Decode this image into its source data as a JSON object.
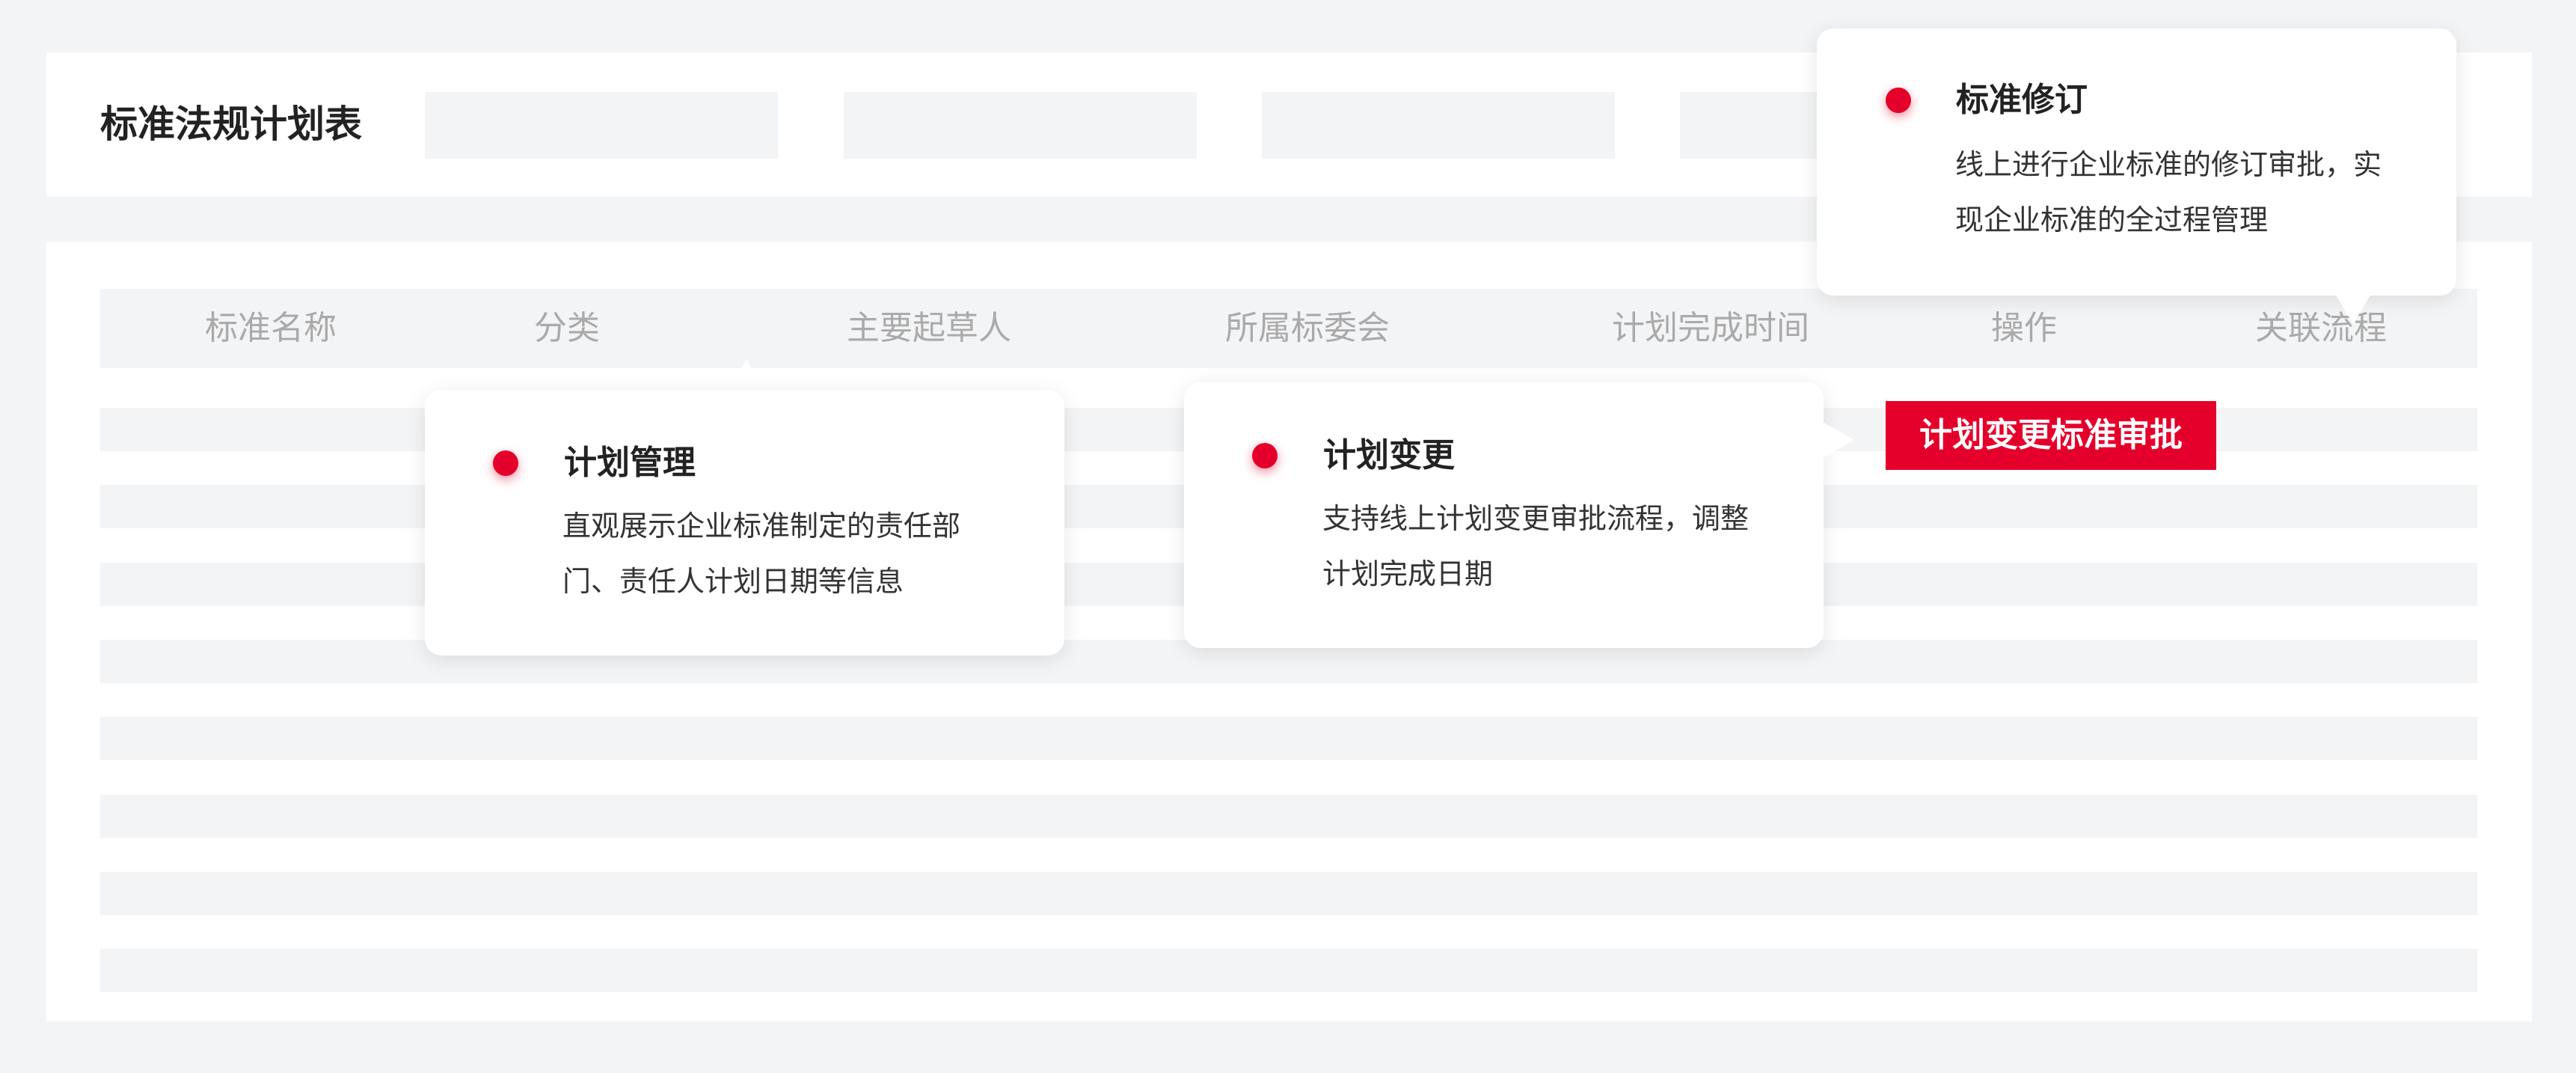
{
  "page": {
    "title": "标准法规计划表"
  },
  "table": {
    "headers": [
      "标准名称",
      "分类",
      "主要起草人",
      "所属标委会",
      "计划完成时间",
      "操作",
      "关联流程"
    ],
    "row_count": 8
  },
  "callouts": {
    "plan_management": {
      "title": "计划管理",
      "description": "直观展示企业标准制定的责任部门、责任人计划日期等信息"
    },
    "plan_change": {
      "title": "计划变更",
      "description": "支持线上计划变更审批流程，调整计划完成日期"
    },
    "standard_revision": {
      "title": "标准修订",
      "description": "线上进行企业标准的修订审批，实现企业标准的全过程管理"
    }
  },
  "approval_tag": {
    "label": "计划变更标准审批"
  },
  "colors": {
    "accent": "#e5002b",
    "background": "#f3f4f6",
    "surface": "#ffffff",
    "header_text": "#aaaaaa"
  }
}
